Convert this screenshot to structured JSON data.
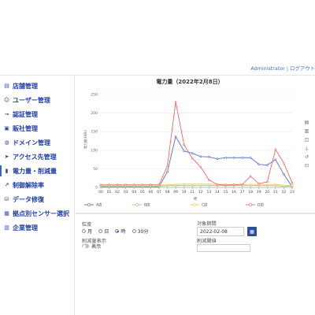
{
  "header": {
    "user_name": "Administrator",
    "separator": "|",
    "logout_label": "ログアウト"
  },
  "sidebar": {
    "items": [
      {
        "label": "店舗管理",
        "icon": "store-icon"
      },
      {
        "label": "ユーザー管理",
        "icon": "users-icon"
      },
      {
        "label": "認証管理",
        "icon": "key-icon"
      },
      {
        "label": "販社管理",
        "icon": "building-icon"
      },
      {
        "label": "ドメイン管理",
        "icon": "globe-icon"
      },
      {
        "label": "アクセス先管理",
        "icon": "send-icon"
      },
      {
        "label": "電力量・削減量",
        "icon": "chart-icon"
      },
      {
        "label": "制御解除率",
        "icon": "line-chart-icon"
      },
      {
        "label": "データ修復",
        "icon": "database-icon"
      },
      {
        "label": "拠点別センサー選択",
        "icon": "grid-icon"
      },
      {
        "label": "企業管理",
        "icon": "company-icon"
      }
    ],
    "active_index": 6
  },
  "toolbox": {
    "icons": [
      "data-view-icon",
      "bar-chart-icon",
      "stack-icon",
      "download-icon",
      "restore-icon",
      "zoom-icon"
    ]
  },
  "chart_data": {
    "type": "line",
    "title": "電力量（2022年2月8日）",
    "xlabel": "時",
    "ylabel": "電力量(kWh)",
    "ylim": [
      0,
      250
    ],
    "yticks": [
      0,
      50,
      100,
      150,
      200,
      250
    ],
    "x": [
      "00",
      "01",
      "02",
      "03",
      "04",
      "05",
      "06",
      "07",
      "08",
      "09",
      "10",
      "11",
      "12",
      "13",
      "14",
      "15",
      "16",
      "17",
      "18",
      "19",
      "20",
      "21",
      "22",
      "23"
    ],
    "grid": true,
    "legend_position": "bottom",
    "series": [
      {
        "name": "A店",
        "color": "#5470c6",
        "values": [
          2,
          2,
          2,
          2,
          2,
          2,
          2,
          2,
          42,
          137,
          98,
          92,
          83,
          82,
          77,
          80,
          80,
          80,
          80,
          62,
          60,
          75,
          35,
          2
        ]
      },
      {
        "name": "B店",
        "color": "#91cc75",
        "values": [
          3,
          3,
          3,
          3,
          3,
          3,
          3,
          3,
          5,
          5,
          5,
          5,
          5,
          5,
          5,
          5,
          5,
          5,
          5,
          5,
          5,
          5,
          3,
          3
        ]
      },
      {
        "name": "C店",
        "color": "#fac858",
        "values": [
          6,
          6,
          6,
          6,
          6,
          6,
          6,
          6,
          7,
          8,
          9,
          9,
          9,
          9,
          8,
          8,
          8,
          8,
          8,
          8,
          8,
          8,
          6,
          5
        ]
      },
      {
        "name": "D店",
        "color": "#ee6666",
        "values": [
          7,
          7,
          7,
          7,
          7,
          7,
          7,
          7,
          58,
          230,
          115,
          78,
          55,
          20,
          8,
          6,
          7,
          8,
          30,
          10,
          15,
          102,
          65,
          12
        ]
      }
    ]
  },
  "form": {
    "granularity_label": "粒度",
    "granularity_options": [
      "月",
      "日",
      "時",
      "30分"
    ],
    "granularity_selected": "時",
    "period_label": "対象期間",
    "period_value": "2022-02-08",
    "reduction_display_label": "削減量表示",
    "reduction_display_option": "表示",
    "threshold_label": "削減閾値",
    "threshold_value": ""
  }
}
